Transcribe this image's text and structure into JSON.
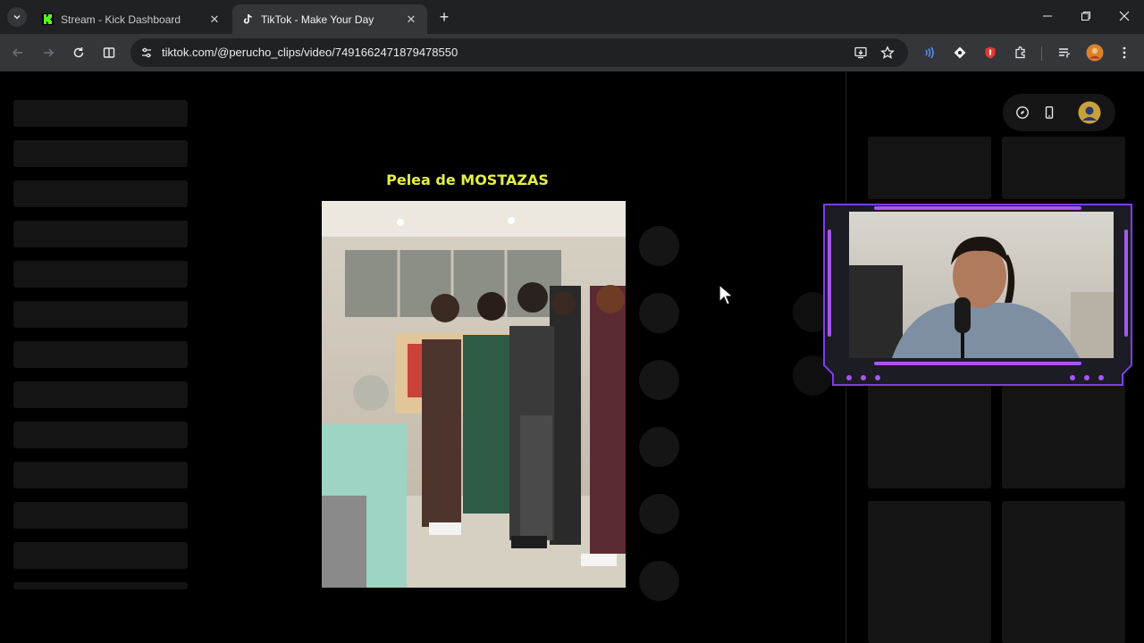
{
  "browser": {
    "tabs": [
      {
        "title": "Stream - Kick Dashboard",
        "favicon": "kick-icon",
        "active": false
      },
      {
        "title": "TikTok - Make Your Day",
        "favicon": "tiktok-icon",
        "active": true
      }
    ],
    "address_bar": {
      "url": "tiktok.com/@perucho_clips/video/7491662471879478550"
    }
  },
  "video": {
    "overlay_title": "Pelea de MOSTAZAS"
  },
  "colors": {
    "accent_title": "#e3f044",
    "kick_green": "#53fc18",
    "cam_frame_purple": "#a855f7"
  }
}
